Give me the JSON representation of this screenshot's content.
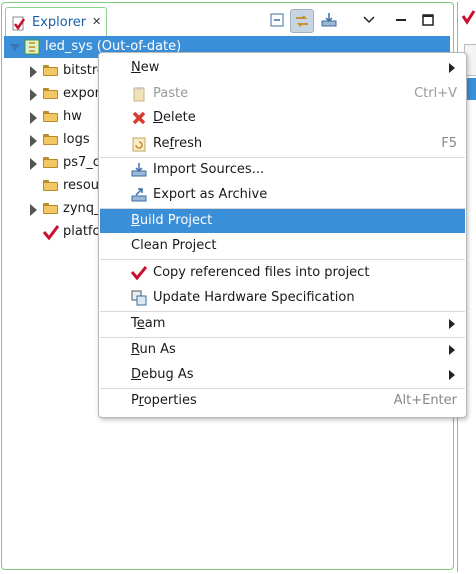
{
  "view": {
    "tab_title": "Explorer",
    "tab_close": "✕"
  },
  "tree": {
    "root_label": "led_sys (Out-of-date)",
    "items": [
      {
        "label": "bitstre",
        "expandable": true
      },
      {
        "label": "expor",
        "expandable": true
      },
      {
        "label": "hw",
        "expandable": true
      },
      {
        "label": "logs",
        "expandable": true
      },
      {
        "label": "ps7_c",
        "expandable": true
      },
      {
        "label": "resou",
        "expandable": false
      },
      {
        "label": "zynq_",
        "expandable": true
      },
      {
        "label": "platfo",
        "expandable": false
      }
    ]
  },
  "menu": {
    "items": [
      {
        "label": "New",
        "mnemonic": "N",
        "submenu": true
      },
      {
        "label": "Paste",
        "accelerator": "Ctrl+V",
        "disabled": true
      },
      {
        "label": "Delete",
        "mnemonic": "D"
      },
      {
        "label": "Refresh",
        "mnemonic": "f",
        "accelerator": "F5"
      },
      {
        "label": "Import Sources..."
      },
      {
        "label": "Export as Archive"
      },
      {
        "label": "Build Project",
        "mnemonic": "B",
        "highlighted": true
      },
      {
        "label": "Clean Project"
      },
      {
        "label": "Copy referenced files into project"
      },
      {
        "label": "Update Hardware Specification"
      },
      {
        "label": "Team",
        "mnemonic": "e",
        "submenu": true
      },
      {
        "label": "Run As",
        "mnemonic": "R",
        "submenu": true
      },
      {
        "label": "Debug As",
        "mnemonic": "D",
        "submenu": true
      },
      {
        "label": "Properties",
        "mnemonic": "r",
        "accelerator": "Alt+Enter"
      }
    ]
  },
  "colors": {
    "selection": "#3b8fd9",
    "view_border": "#7fc97f",
    "delete_icon": "#d83a2f",
    "xilinx_red": "#c8102e"
  }
}
